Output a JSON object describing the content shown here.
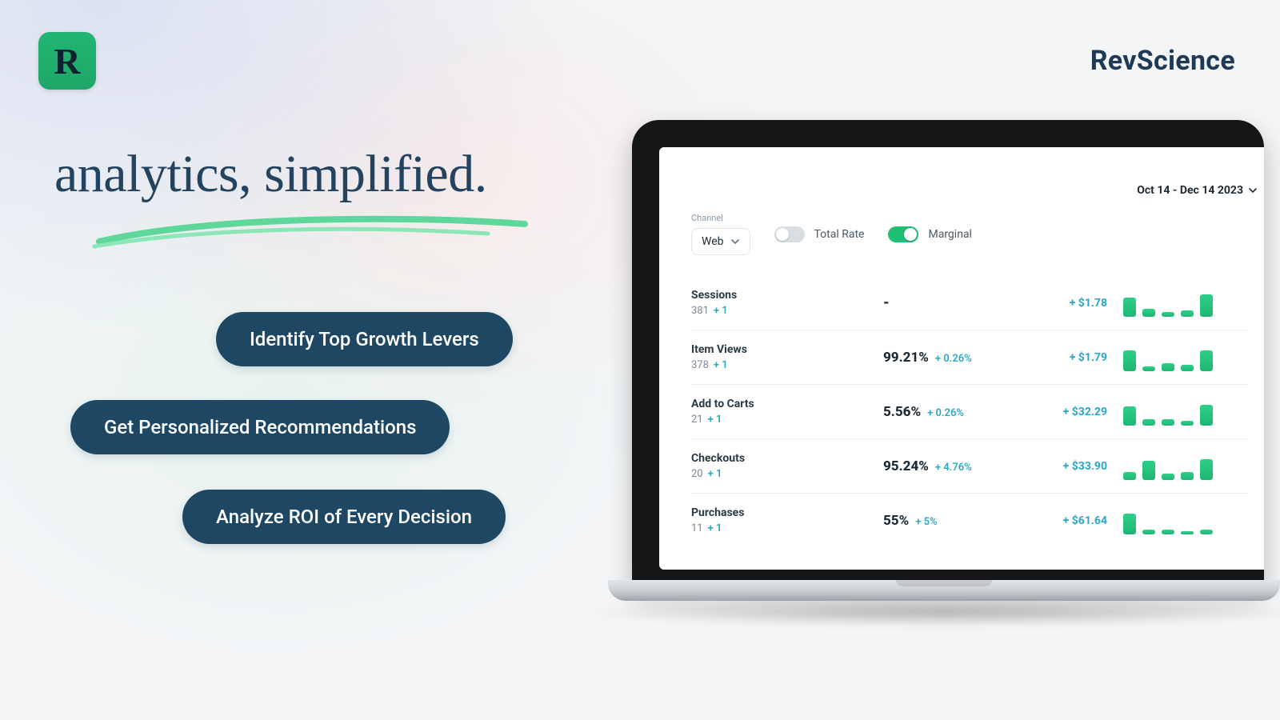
{
  "brand": {
    "logo_letter": "R",
    "name": "RevScience"
  },
  "hero": {
    "headline": "analytics, simplified.",
    "pills": [
      "Identify Top Growth Levers",
      "Get Personalized Recommendations",
      "Analyze ROI of Every Decision"
    ]
  },
  "dashboard": {
    "date_range": "Oct 14 - Dec 14 2023",
    "channel": {
      "label": "Channel",
      "value": "Web"
    },
    "toggles": {
      "total_rate": {
        "label": "Total Rate",
        "on": false
      },
      "marginal": {
        "label": "Marginal",
        "on": true
      }
    },
    "metrics": [
      {
        "name": "Sessions",
        "count": "381",
        "count_delta": "+ 1",
        "rate": "-",
        "rate_delta": "",
        "value": "+ $1.78",
        "spark": [
          24,
          10,
          6,
          8,
          28
        ]
      },
      {
        "name": "Item Views",
        "count": "378",
        "count_delta": "+ 1",
        "rate": "99.21%",
        "rate_delta": "+ 0.26%",
        "value": "+ $1.79",
        "spark": [
          26,
          6,
          10,
          8,
          26
        ]
      },
      {
        "name": "Add to Carts",
        "count": "21",
        "count_delta": "+ 1",
        "rate": "5.56%",
        "rate_delta": "+ 0.26%",
        "value": "+ $32.29",
        "spark": [
          24,
          8,
          8,
          6,
          26
        ]
      },
      {
        "name": "Checkouts",
        "count": "20",
        "count_delta": "+ 1",
        "rate": "95.24%",
        "rate_delta": "+ 4.76%",
        "value": "+ $33.90",
        "spark": [
          10,
          24,
          8,
          10,
          26
        ]
      },
      {
        "name": "Purchases",
        "count": "11",
        "count_delta": "+ 1",
        "rate": "55%",
        "rate_delta": "+ 5%",
        "value": "+ $61.64",
        "spark": [
          26,
          6,
          6,
          4,
          6
        ]
      }
    ]
  },
  "colors": {
    "navy": "#1e4764",
    "green": "#1fbf75",
    "teal_text": "#2aa8c9"
  }
}
